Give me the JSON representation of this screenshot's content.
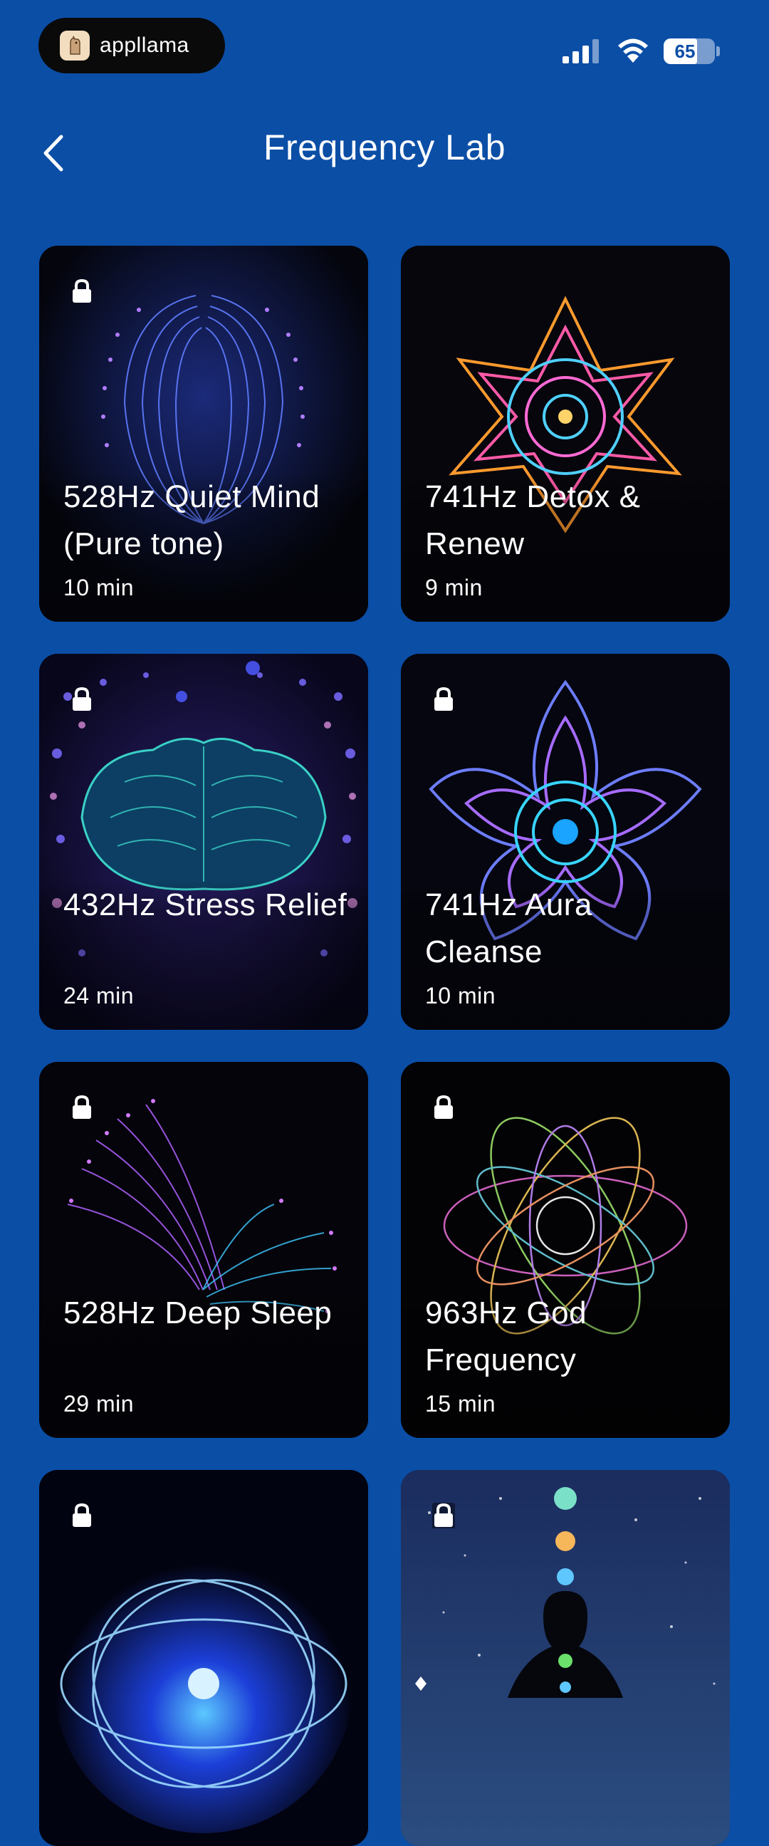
{
  "status_bar": {
    "app_name": "appllama",
    "battery": "65",
    "battery_level": 0.65,
    "icons": [
      "signal-icon",
      "wifi-icon",
      "battery-icon"
    ]
  },
  "header": {
    "title": "Frequency Lab",
    "back_icon": "chevron-left-icon"
  },
  "cards": [
    {
      "title": "528Hz Quiet Mind (Pure tone)",
      "duration": "10 min",
      "locked": true,
      "art": "brain-lines"
    },
    {
      "title": "741Hz Detox & Renew",
      "duration": "9 min",
      "locked": false,
      "art": "neon-lotus"
    },
    {
      "title": "432Hz Stress Relief",
      "duration": "24 min",
      "locked": true,
      "art": "teal-brain-dots"
    },
    {
      "title": "741Hz Aura Cleanse",
      "duration": "10 min",
      "locked": true,
      "art": "blue-lotus"
    },
    {
      "title": "528Hz Deep Sleep",
      "duration": "29 min",
      "locked": true,
      "art": "purple-swirl"
    },
    {
      "title": "963Hz God Frequency",
      "duration": "15 min",
      "locked": true,
      "art": "flower-of-life"
    },
    {
      "title": "",
      "duration": "",
      "locked": true,
      "art": "blue-orb"
    },
    {
      "title": "",
      "duration": "",
      "locked": true,
      "art": "chakra-figure"
    }
  ],
  "colors": {
    "background": "#0b4ea6",
    "card": "#05060d",
    "text": "#ffffff"
  }
}
